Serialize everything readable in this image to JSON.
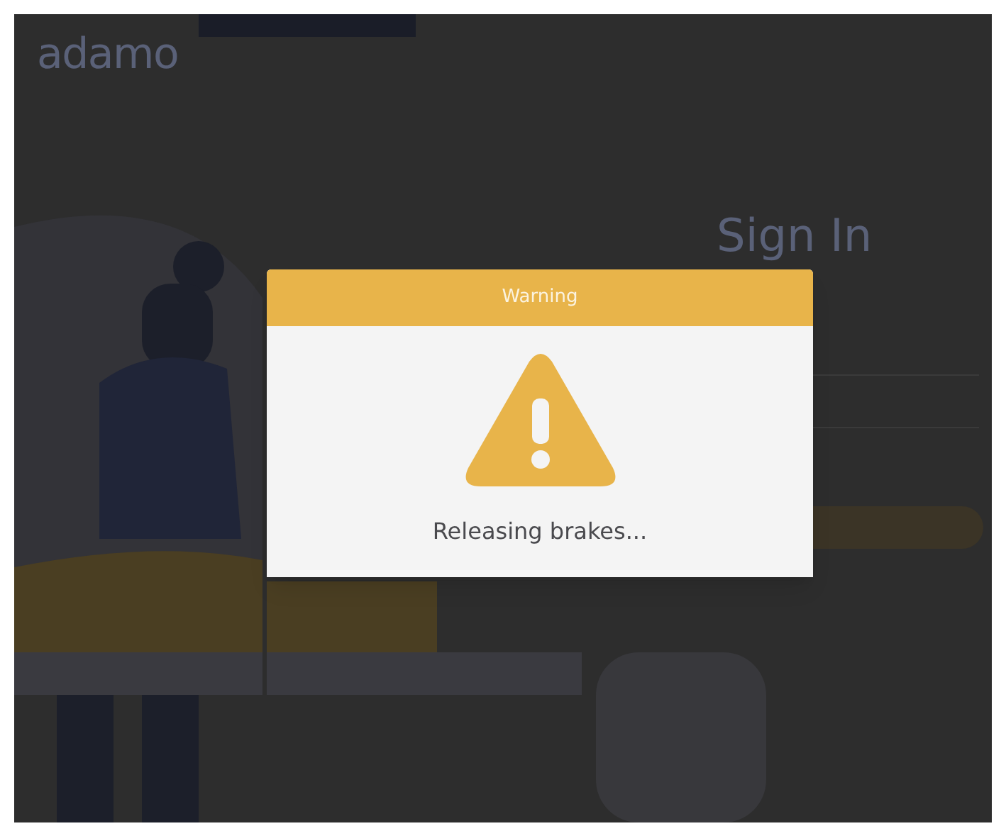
{
  "background_page": {
    "logo": "adamo",
    "heading": "Sign In"
  },
  "dialog": {
    "title": "Warning",
    "message": "Releasing brakes..."
  }
}
